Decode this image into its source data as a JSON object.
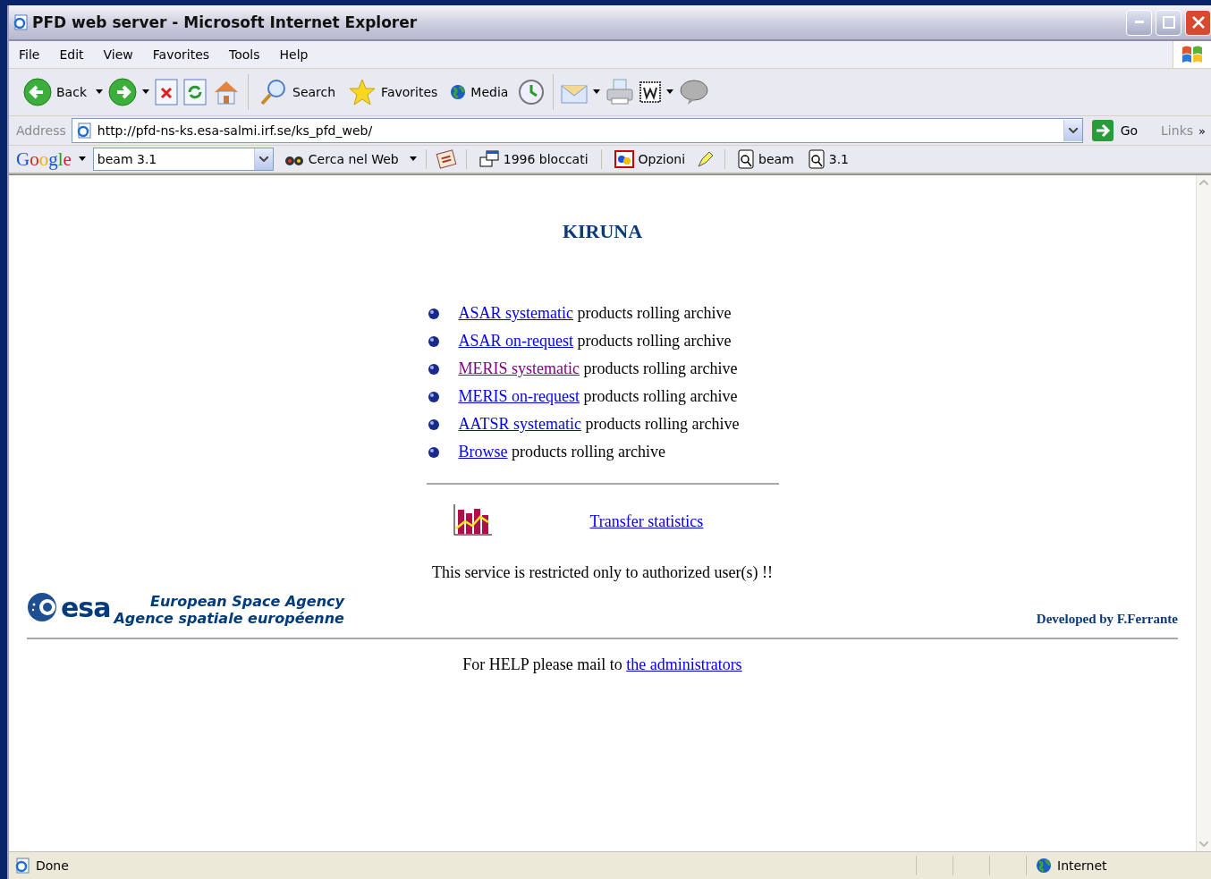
{
  "window": {
    "title": "PFD web server - Microsoft Internet Explorer"
  },
  "menu": [
    "File",
    "Edit",
    "View",
    "Favorites",
    "Tools",
    "Help"
  ],
  "toolbar": [
    {
      "kind": "back",
      "label": "Back",
      "dropdown": true
    },
    {
      "kind": "forward",
      "dropdown": true
    },
    {
      "kind": "stop",
      "dropdown": false
    },
    {
      "kind": "refresh",
      "dropdown": false
    },
    {
      "kind": "home",
      "dropdown": false
    },
    {
      "kind": "search",
      "label": "Search",
      "dropdown": false
    },
    {
      "kind": "favorites",
      "label": "Favorites",
      "dropdown": false
    },
    {
      "kind": "media",
      "label": "Media",
      "dropdown": false
    },
    {
      "kind": "history",
      "dropdown": false
    },
    {
      "kind": "mail",
      "dropdown": true
    },
    {
      "kind": "print",
      "dropdown": false
    },
    {
      "kind": "edit",
      "dropdown": true
    },
    {
      "kind": "discuss",
      "dropdown": false
    }
  ],
  "address": {
    "label": "Address",
    "value": "http://pfd-ns-ks.esa-salmi.irf.se/ks_pfd_web/",
    "go": "Go",
    "links": "Links",
    "more": "»"
  },
  "google_bar": {
    "logo": "Google",
    "query": "beam 3.1",
    "search": "Cerca nel Web",
    "blocked": "1996 bloccati",
    "options": "Opzioni",
    "terms": [
      "beam",
      "3.1"
    ]
  },
  "page": {
    "heading": "KIRUNA",
    "archives": [
      {
        "link": "ASAR systematic",
        "text": "products rolling archive",
        "visited": false
      },
      {
        "link": "ASAR on-request",
        "text": "products rolling archive",
        "visited": false
      },
      {
        "link": "MERIS systematic",
        "text": "products rolling archive",
        "visited": true
      },
      {
        "link": "MERIS on-request",
        "text": "products rolling archive",
        "visited": false
      },
      {
        "link": "AATSR systematic",
        "text": "products rolling archive",
        "visited": false
      },
      {
        "link": "Browse",
        "text": "products rolling archive",
        "visited": false
      }
    ],
    "stats_link": "Transfer statistics",
    "notice": "This service is restricted only to authorized user(s) !!",
    "logo": {
      "mark": "esa",
      "line_1": "European Space Agency",
      "line_2": "Agence spatiale européenne"
    },
    "credit": "Developed by F.Ferrante",
    "help_text": "For HELP please mail to",
    "help_link": "the administrators"
  },
  "status_bar": {
    "text": "Done",
    "zone": "Internet"
  }
}
